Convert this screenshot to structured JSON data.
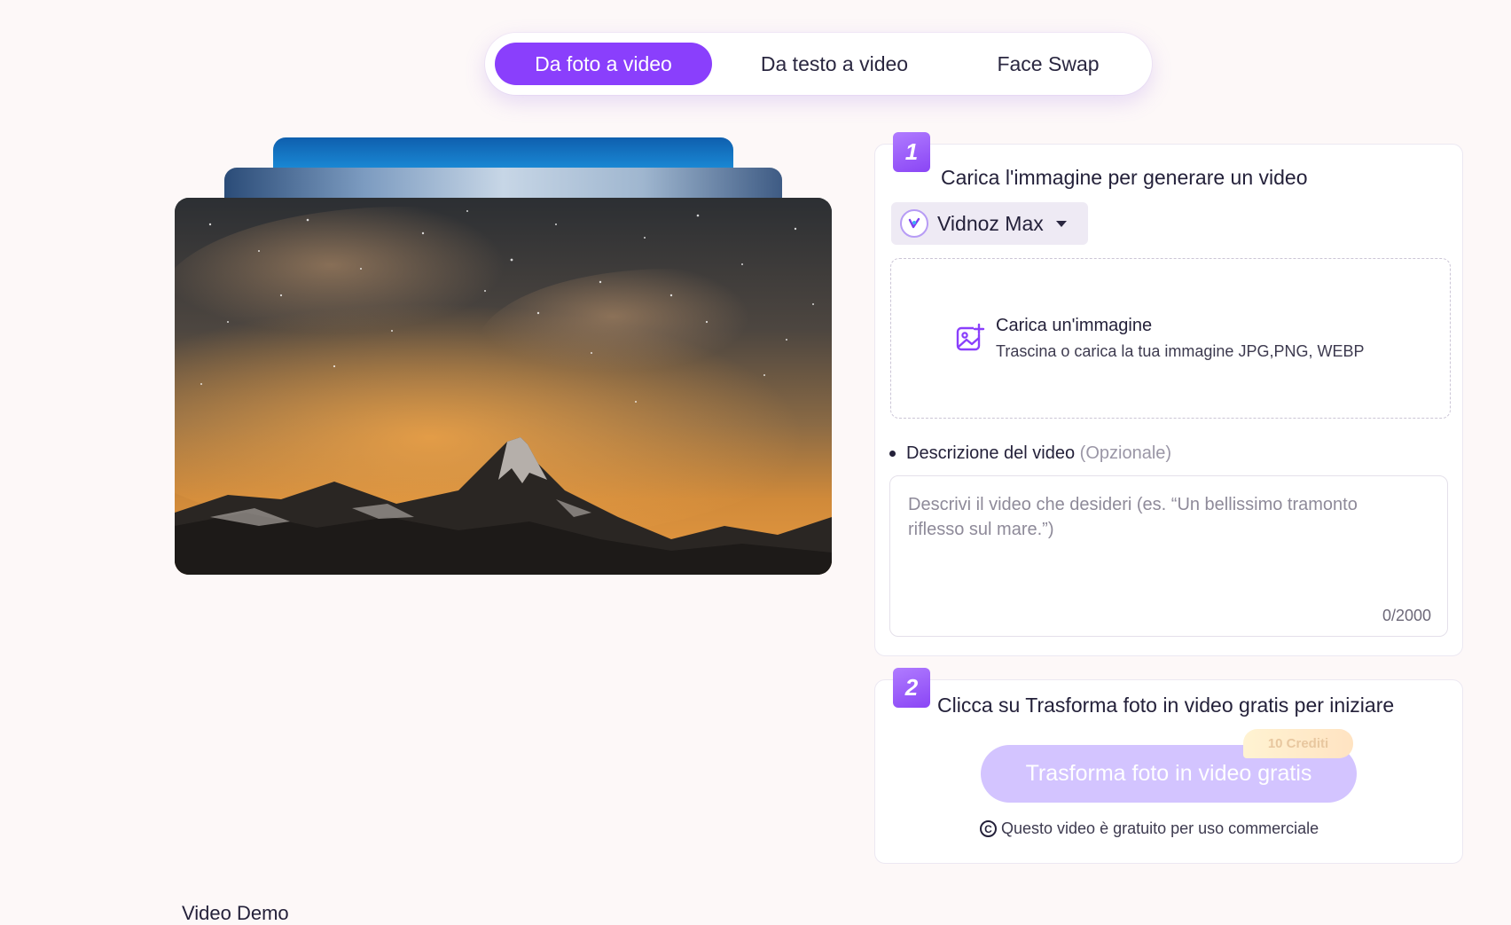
{
  "tabs": [
    {
      "label": "Da foto a video",
      "active": true
    },
    {
      "label": "Da testo a video",
      "active": false
    },
    {
      "label": "Face Swap",
      "active": false
    }
  ],
  "step1": {
    "number": "1",
    "title": "Carica l'immagine per generare un video",
    "model": {
      "name": "Vidnoz Max",
      "icon": "vidnoz-logo-icon"
    },
    "upload": {
      "icon": "image-add-icon",
      "title": "Carica un'immagine",
      "subtitle": "Trascina o carica la tua immagine JPG,PNG, WEBP"
    },
    "description": {
      "label": "Descrizione del video",
      "optional": "(Opzionale)",
      "placeholder": "Descrivi il video che desideri (es. “Un bellissimo tramonto riflesso sul mare.”)",
      "value": "",
      "counter": "0/2000"
    }
  },
  "step2": {
    "number": "2",
    "title": "Clicca su Trasforma foto in video gratis per iniziare",
    "button_label": "Trasforma foto in video gratis",
    "credits": "10 Crediti",
    "commercial_icon": "copyright-icon",
    "commercial_note": "Questo video è gratuito per uso commerciale"
  },
  "footer": {
    "video_demo": "Video Demo"
  },
  "colors": {
    "accent": "#8a3ffc",
    "button_disabled": "#d3c4ff",
    "background": "#fdf8f8"
  }
}
